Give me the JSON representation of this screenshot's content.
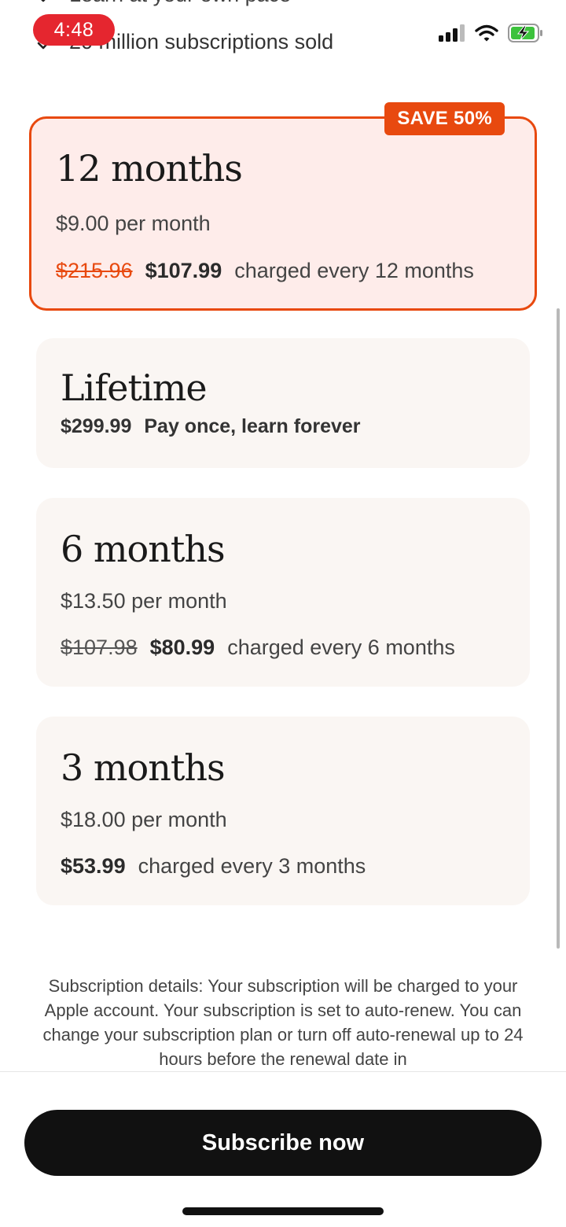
{
  "status_bar": {
    "time": "4:48"
  },
  "benefits": [
    {
      "text": "Learn at your own pace"
    },
    {
      "text": "20 million subscriptions sold"
    }
  ],
  "plans": [
    {
      "title": "12 months",
      "per_month": "$9.00 per month",
      "old_price": "$215.96",
      "price": "$107.99",
      "billing": "charged every 12 months",
      "badge": "SAVE 50%",
      "selected": true
    },
    {
      "title": "Lifetime",
      "price": "$299.99",
      "billing": "Pay once, learn forever"
    },
    {
      "title": "6 months",
      "per_month": "$13.50 per month",
      "old_price": "$107.98",
      "price": "$80.99",
      "billing": "charged every 6 months"
    },
    {
      "title": "3 months",
      "per_month": "$18.00 per month",
      "price": "$53.99",
      "billing": "charged every 3 months"
    }
  ],
  "details_text": "Subscription details: Your subscription will be charged to your Apple account. Your subscription is set to auto-renew. You can change your subscription plan or turn off auto-renewal up to 24 hours before the renewal date in",
  "cta": {
    "label": "Subscribe now"
  },
  "colors": {
    "accent": "#e8490f",
    "selected_bg": "#feecea",
    "card_bg": "#faf6f3",
    "button": "#111111",
    "time_pill": "#e5262f",
    "battery": "#3cc23c"
  }
}
